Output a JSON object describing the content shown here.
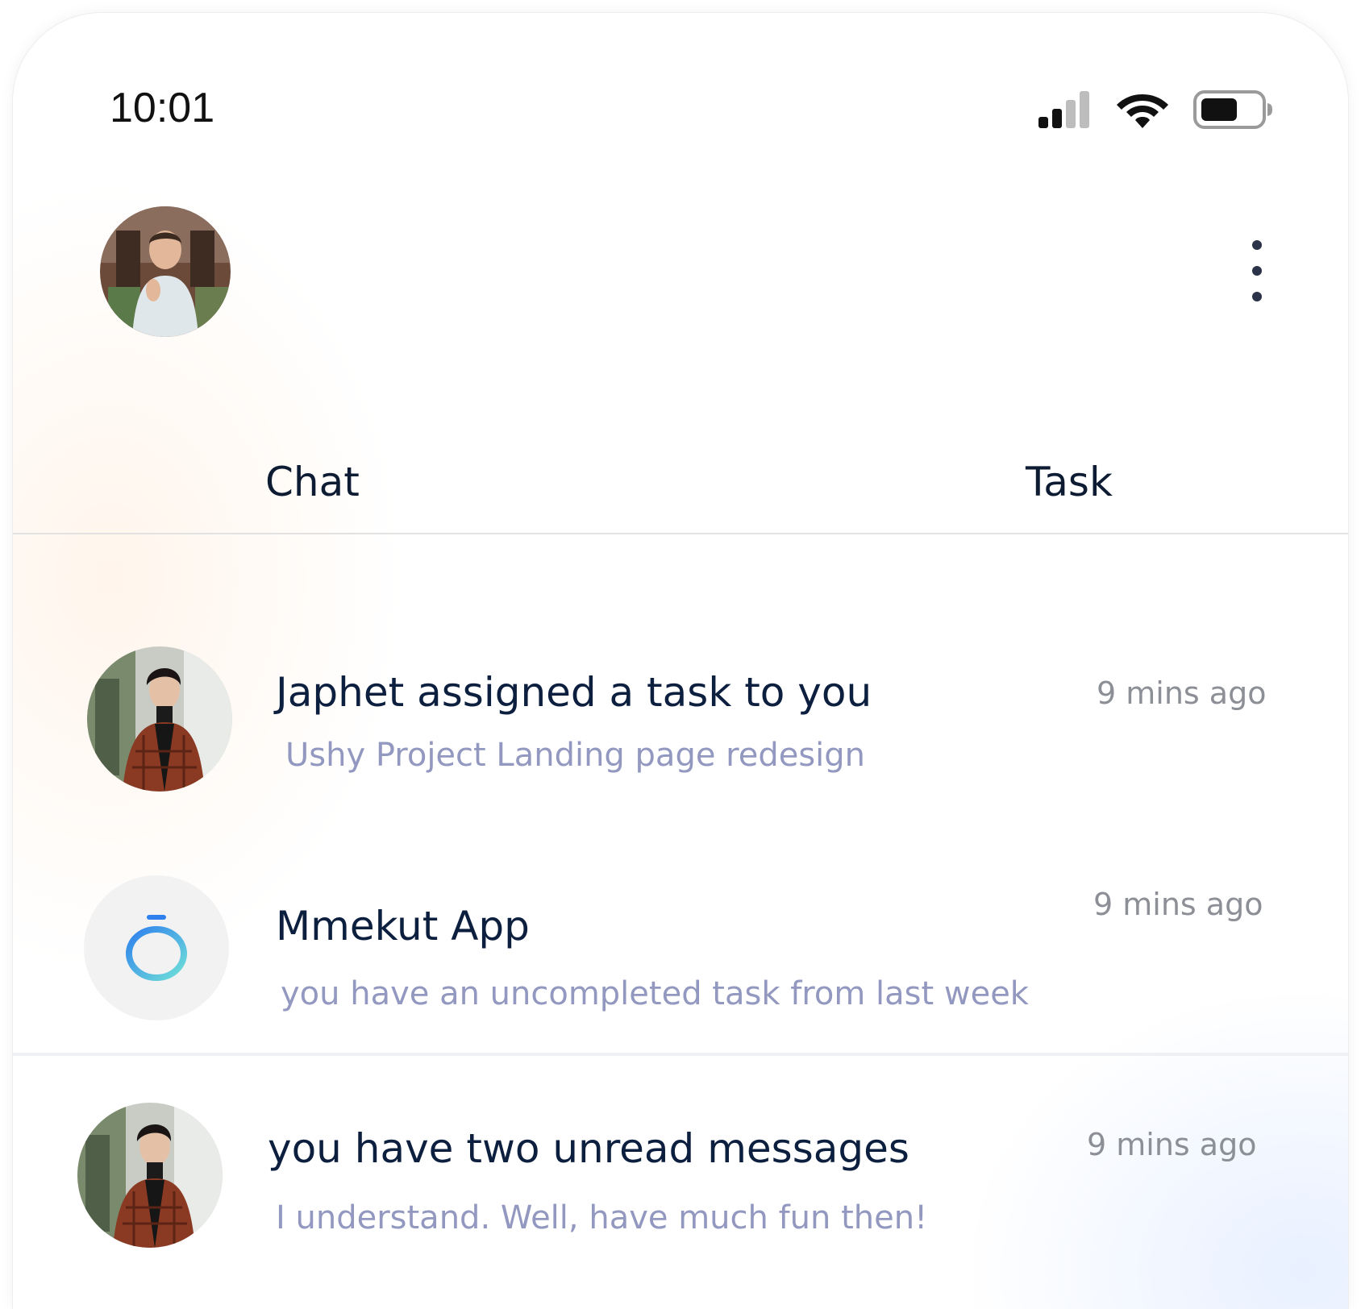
{
  "status_bar": {
    "time": "10:01",
    "icons": [
      "signal-icon",
      "wifi-icon",
      "battery-icon"
    ]
  },
  "header": {
    "avatar": "profile-avatar",
    "menu_icon": "more-vertical-icon"
  },
  "tabs": [
    {
      "label": "Chat"
    },
    {
      "label": "Task"
    }
  ],
  "notifications": [
    {
      "avatar": "user-avatar-japhet",
      "title": "Japhet assigned a task to you",
      "subtitle": "Ushy Project Landing page redesign",
      "time": "9 mins ago"
    },
    {
      "avatar": "mmekut-app-logo",
      "title": "Mmekut App",
      "subtitle": "you have an uncompleted task from last week",
      "time": "9 mins ago"
    },
    {
      "avatar": "user-avatar-japhet",
      "title": "you have two unread messages",
      "subtitle": "I understand. Well, have much fun then!",
      "time": "9 mins ago"
    }
  ],
  "colors": {
    "title": "#0d1f3f",
    "subtitle": "#9298bf",
    "time": "#8d8f96",
    "app_logo_gradient": [
      "#2f80ed",
      "#6fe0d8"
    ]
  }
}
